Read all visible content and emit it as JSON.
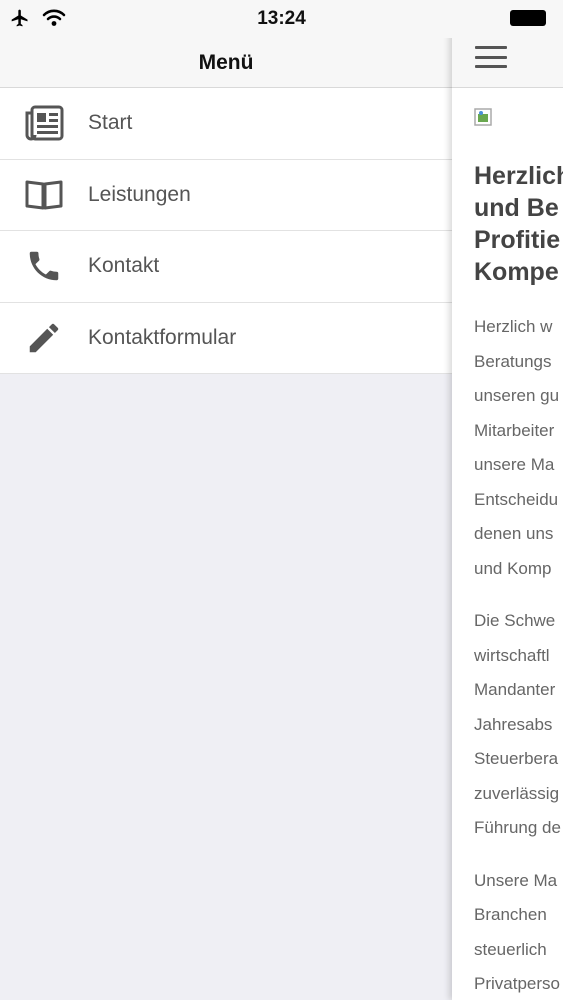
{
  "statusbar": {
    "time": "13:24"
  },
  "menu": {
    "title": "Menü",
    "items": [
      {
        "label": "Start",
        "icon": "newspaper-icon"
      },
      {
        "label": "Leistungen",
        "icon": "book-icon"
      },
      {
        "label": "Kontakt",
        "icon": "phone-icon"
      },
      {
        "label": "Kontaktformular",
        "icon": "pencil-icon"
      }
    ]
  },
  "content": {
    "heading": [
      "Herzlich",
      "und Be",
      "Profitie",
      "Kompe"
    ],
    "paragraphs": [
      [
        "Herzlich w",
        "Beratungs",
        "unseren gu",
        "Mitarbeiter",
        "unsere Ma",
        "Entscheidu",
        "denen uns",
        "und Komp"
      ],
      [
        "Die Schwe",
        "wirtschaftl",
        "Mandanter",
        "Jahresabs",
        "Steuerbera",
        "zuverlässig",
        "Führung de"
      ],
      [
        "Unsere Ma",
        "Branchen",
        "steuerlich",
        "Privatperso"
      ]
    ]
  }
}
